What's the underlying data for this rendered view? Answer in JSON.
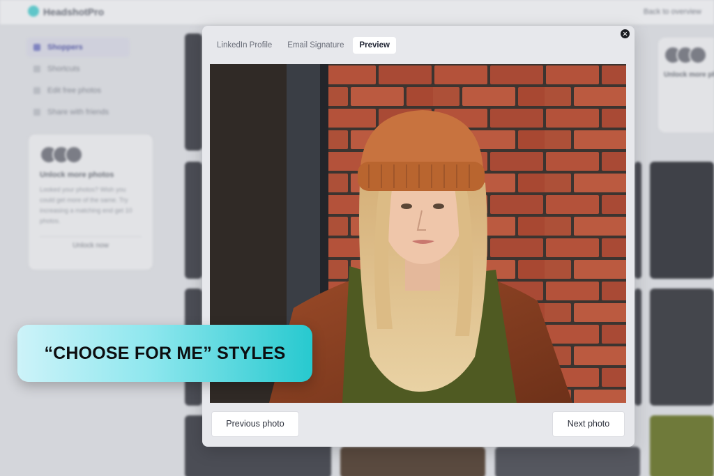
{
  "background_app": {
    "logo_text": "HeadshotPro",
    "back_link": "Back to overview",
    "nav_items": [
      {
        "label": "Shoppers",
        "active": true
      },
      {
        "label": "Shortcuts",
        "active": false
      },
      {
        "label": "Edit free photos",
        "active": false
      },
      {
        "label": "Share with friends",
        "active": false
      }
    ],
    "unlock_card": {
      "title": "Unlock more photos",
      "text": "Looked your photos? Wish you could get more of the same. Try increasing a matching end get 10 photos.",
      "button": "Unlock now"
    },
    "right_card_title": "Unlock more pho"
  },
  "modal": {
    "tabs": [
      {
        "label": "LinkedIn Profile",
        "active": false
      },
      {
        "label": "Email Signature",
        "active": false
      },
      {
        "label": "Preview",
        "active": true
      }
    ],
    "previous_label": "Previous photo",
    "next_label": "Next photo"
  },
  "banner": {
    "text": "“CHOOSE FOR ME” STYLES"
  },
  "colors": {
    "banner_start": "#cdf3f9",
    "banner_end": "#27c9cf",
    "brick": "#b4523a",
    "beanie": "#c8733f"
  }
}
